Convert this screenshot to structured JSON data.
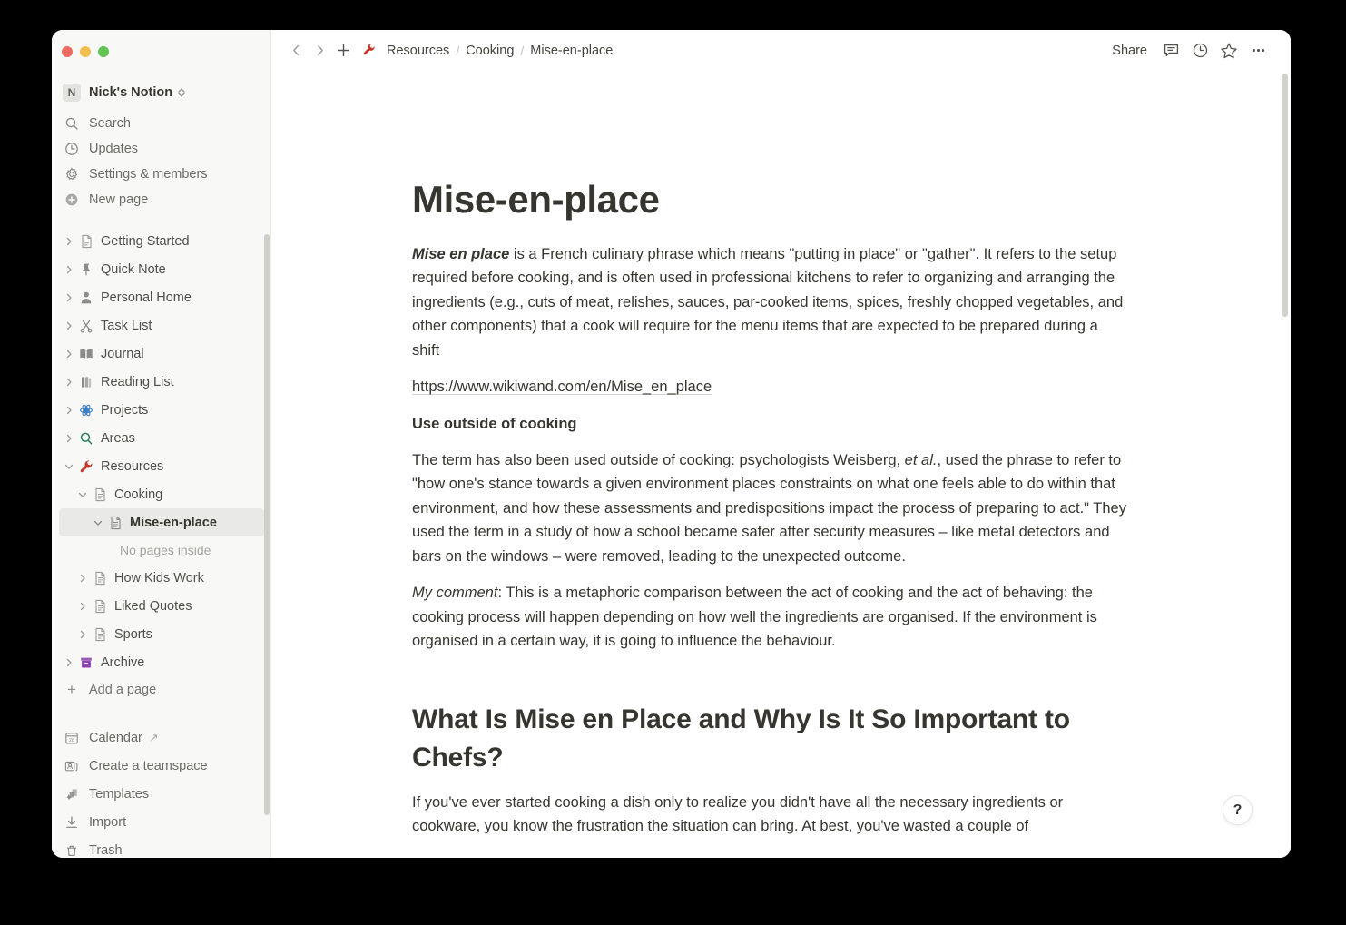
{
  "window": {
    "traffic_lights": [
      "close",
      "minimize",
      "maximize"
    ],
    "colors": {
      "close": "#ed6a5e",
      "minimize": "#f4bd4f",
      "maximize": "#61c454",
      "accent_selected": "#e9e9e7",
      "sidebar_bg": "#f8f8f7"
    }
  },
  "sidebar": {
    "workspace": {
      "badge": "N",
      "name": "Nick's Notion",
      "chevron": "updown-chevron-icon"
    },
    "nav": [
      {
        "icon": "search-icon",
        "label": "Search"
      },
      {
        "icon": "clock-icon",
        "label": "Updates"
      },
      {
        "icon": "gear-icon",
        "label": "Settings & members"
      },
      {
        "icon": "plus-circle-icon",
        "label": "New page"
      }
    ],
    "tree": [
      {
        "level": 0,
        "twisty": "right",
        "icon": "page-icon",
        "label": "Getting Started",
        "selected": false
      },
      {
        "level": 0,
        "twisty": "right",
        "icon": "pushpin-icon",
        "label": "Quick Note",
        "selected": false
      },
      {
        "level": 0,
        "twisty": "right",
        "icon": "person-icon",
        "label": "Personal Home",
        "selected": false
      },
      {
        "level": 0,
        "twisty": "right",
        "icon": "scissors-icon",
        "label": "Task List",
        "selected": false
      },
      {
        "level": 0,
        "twisty": "right",
        "icon": "open-book-icon",
        "label": "Journal",
        "selected": false
      },
      {
        "level": 0,
        "twisty": "right",
        "icon": "books-icon",
        "label": "Reading List",
        "selected": false
      },
      {
        "level": 0,
        "twisty": "right",
        "icon": "atom-icon",
        "label": "Projects",
        "selected": false
      },
      {
        "level": 0,
        "twisty": "right",
        "icon": "magnifier-icon",
        "label": "Areas",
        "selected": false
      },
      {
        "level": 0,
        "twisty": "down",
        "icon": "wrench-icon",
        "label": "Resources",
        "selected": false
      },
      {
        "level": 1,
        "twisty": "down",
        "icon": "page-icon",
        "label": "Cooking",
        "selected": false
      },
      {
        "level": 2,
        "twisty": "down",
        "icon": "page-icon",
        "label": "Mise-en-place",
        "selected": true
      }
    ],
    "empty_label": "No pages inside",
    "tree_after": [
      {
        "level": 1,
        "twisty": "right",
        "icon": "page-icon",
        "label": "How Kids Work",
        "selected": false
      },
      {
        "level": 1,
        "twisty": "right",
        "icon": "page-icon",
        "label": "Liked Quotes",
        "selected": false
      },
      {
        "level": 1,
        "twisty": "right",
        "icon": "page-icon",
        "label": "Sports",
        "selected": false
      },
      {
        "level": 0,
        "twisty": "right",
        "icon": "archive-box-icon",
        "label": "Archive",
        "selected": false
      }
    ],
    "add_page_label": "Add a page",
    "bottom": [
      {
        "icon": "calendar-icon",
        "label": "Calendar",
        "external": true
      },
      {
        "icon": "teamspace-icon",
        "label": "Create a teamspace",
        "external": false
      },
      {
        "icon": "templates-icon",
        "label": "Templates",
        "external": false
      },
      {
        "icon": "import-icon",
        "label": "Import",
        "external": false
      },
      {
        "icon": "trash-icon",
        "label": "Trash",
        "external": false
      }
    ]
  },
  "topbar": {
    "back_icon": "chevron-left-icon",
    "forward_icon": "chevron-right-icon",
    "new_icon": "plus-icon",
    "breadcrumb_emoji": "wrench-icon",
    "breadcrumbs": [
      "Resources",
      "Cooking",
      "Mise-en-place"
    ],
    "separator": "/",
    "share_label": "Share",
    "right_icons": [
      "comment-icon",
      "updates-clock-icon",
      "favorite-star-icon",
      "more-options-icon"
    ]
  },
  "document": {
    "title": "Mise-en-place",
    "p1_lead": "Mise en place",
    "p1_rest": " is a French culinary phrase which means \"putting in place\" or \"gather\". It refers to the setup required before cooking, and is often used in professional kitchens to refer to organizing and arranging the ingredients (e.g., cuts of meat, relishes, sauces, par-cooked items, spices, freshly chopped vegetables, and other components) that a cook will require for the menu items that are expected to be prepared during a shift",
    "link": "https://www.wikiwand.com/en/Mise_en_place",
    "subheading": "Use outside of cooking",
    "p2_a": "The term has also been used outside of cooking: psychologists Weisberg, ",
    "p2_em": "et al.",
    "p2_b": ", used the phrase to refer to \"how one's stance towards a given environment places constraints on what one feels able to do within that environment, and how these assessments and predispositions impact the process of preparing to act.\" They used the term in a study of how a school became safer after security measures – like metal detectors and bars on the windows – were removed, leading to the unexpected outcome.",
    "p3_em": "My comment",
    "p3_rest": ": This is a metaphoric comparison between the act of cooking and the act of behaving: the cooking process will happen depending on how well the ingredients are organised. If the environment is organised in a certain way, it is going to influence the behaviour.",
    "heading2": "What Is Mise en Place and Why Is It So Important to Chefs?",
    "p4": "If you've ever started cooking a dish only to realize you didn't have all the necessary ingredients or cookware, you know the frustration the situation can bring. At best, you've wasted a couple of",
    "help_label": "?"
  }
}
